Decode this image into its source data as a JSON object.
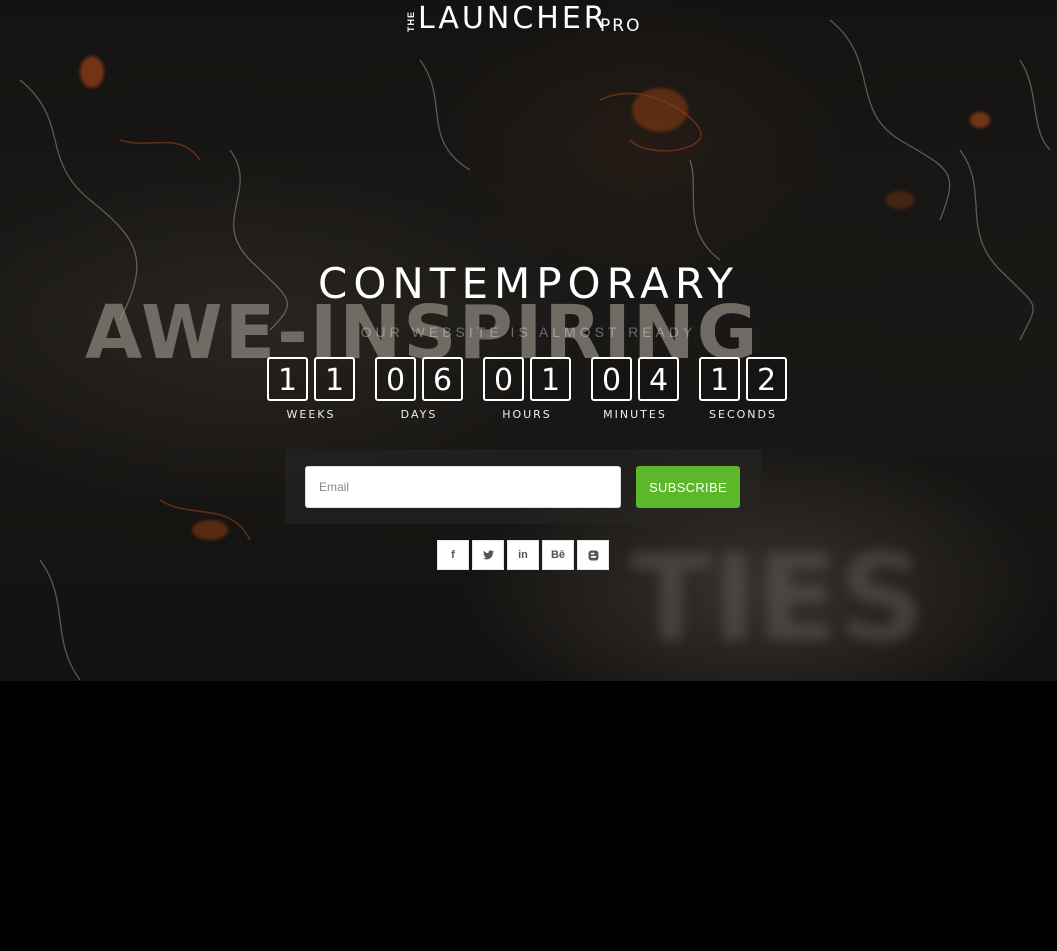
{
  "logo": {
    "the": "THE",
    "main": "LAUNCHER",
    "pro": "PRO"
  },
  "headline": "CONTEMPORARY",
  "subline": "OUR WEBSITE IS ALMOST READY",
  "countdown": [
    {
      "unit": "WEEKS",
      "digits": [
        "1",
        "1"
      ]
    },
    {
      "unit": "DAYS",
      "digits": [
        "0",
        "6"
      ]
    },
    {
      "unit": "HOURS",
      "digits": [
        "0",
        "1"
      ]
    },
    {
      "unit": "MINUTES",
      "digits": [
        "0",
        "4"
      ]
    },
    {
      "unit": "SECONDS",
      "digits": [
        "1",
        "2"
      ]
    }
  ],
  "subscribe": {
    "placeholder": "Email",
    "button_label": "SUBSCRIBE"
  },
  "social": [
    {
      "icon": "facebook-icon",
      "glyph": "f"
    },
    {
      "icon": "twitter-icon",
      "glyph": "🐦"
    },
    {
      "icon": "linkedin-icon",
      "glyph": "in"
    },
    {
      "icon": "behance-icon",
      "glyph": "Bē"
    },
    {
      "icon": "blogger-icon",
      "glyph": "B"
    }
  ],
  "colors": {
    "accent": "#5cb82a",
    "background": "#000000"
  }
}
